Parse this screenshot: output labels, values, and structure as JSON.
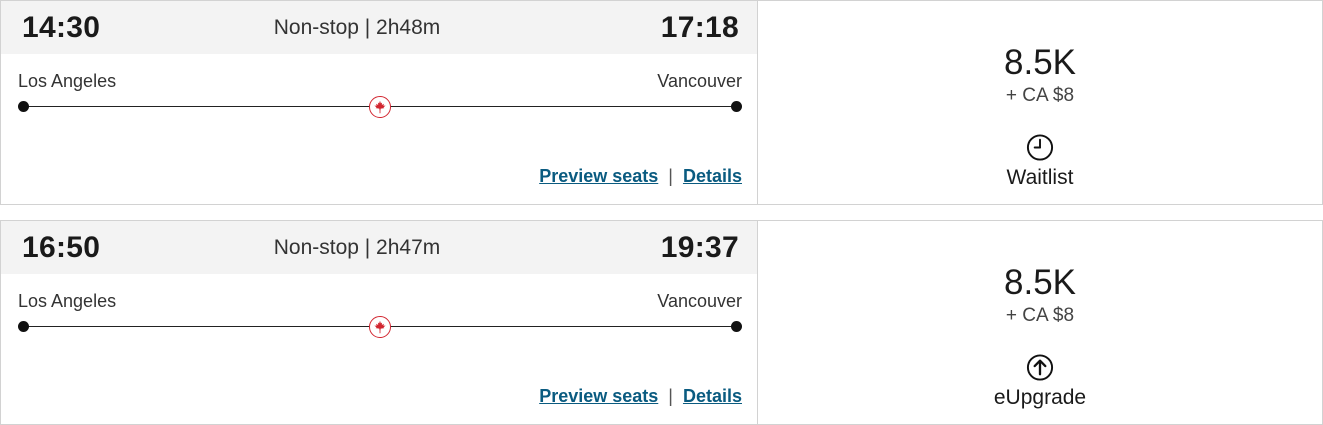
{
  "flights": [
    {
      "departure_time": "14:30",
      "arrival_time": "17:18",
      "duration": "Non-stop | 2h48m",
      "origin": "Los Angeles",
      "destination": "Vancouver",
      "preview_seats_label": "Preview seats ",
      "separator": "|",
      "details_label": " Details",
      "points": "8.5K",
      "cash": "+ CA $8",
      "status_icon": "clock-icon",
      "status_label": "Waitlist"
    },
    {
      "departure_time": "16:50",
      "arrival_time": "19:37",
      "duration": "Non-stop | 2h47m",
      "origin": "Los Angeles",
      "destination": "Vancouver",
      "preview_seats_label": "Preview seats ",
      "separator": "|",
      "details_label": " Details",
      "points": "8.5K",
      "cash": "+ CA $8",
      "status_icon": "upgrade-arrow-icon",
      "status_label": "eUpgrade"
    }
  ],
  "colors": {
    "link": "#0a5b80",
    "brand_red": "#d22630",
    "time_bar_bg": "#f3f3f3",
    "border": "#d2d2d2"
  }
}
